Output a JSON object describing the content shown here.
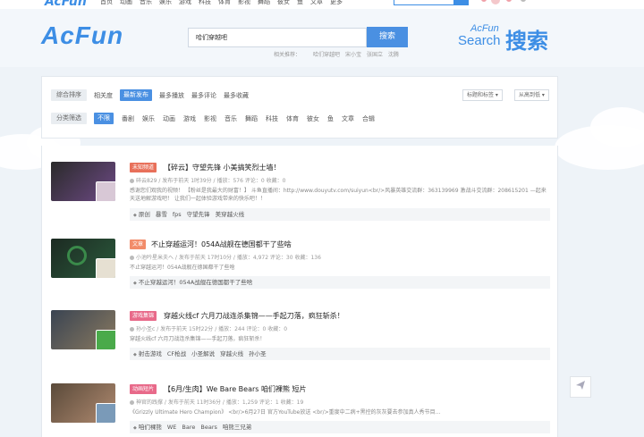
{
  "topbar": {
    "logo": "AcFun",
    "nav": [
      "首页",
      "动画",
      "音乐",
      "娱乐",
      "游戏",
      "科技",
      "体育",
      "影视",
      "舞蹈",
      "彼女",
      "鱼",
      "文章",
      "更多"
    ],
    "search_placeholder": "搜索"
  },
  "header": {
    "logo": "AcFun",
    "search_value": "哈们穿越吧",
    "search_button": "搜索",
    "hot_label": "相关推荐：",
    "hot_links": [
      "哈们穿越吧",
      "宋小宝",
      "张国立",
      "沈腾"
    ],
    "brand_en1": "AcFun",
    "brand_en2": "Search",
    "brand_cn": "搜索"
  },
  "filters": {
    "sort_label": "综合排序",
    "sort_items": [
      "相关度",
      "最新发布",
      "最多播放",
      "最多评论",
      "最多收藏"
    ],
    "sort_active": 1,
    "cat_label": "分类筛选",
    "cat_items": [
      "不限",
      "番剧",
      "娱乐",
      "动画",
      "游戏",
      "影视",
      "音乐",
      "舞蹈",
      "科技",
      "体育",
      "彼女",
      "鱼",
      "文章",
      "合辑"
    ],
    "cat_active": 0,
    "select_tags": "标题和标签 ▾",
    "select_time": "从高到低 ▾"
  },
  "entries": [
    {
      "tag": "未知频道",
      "tag_color": "#e8705a",
      "title": "【碎云】守望先锋 小美搞笑烈士墙！",
      "meta": "碎云829 / 发布于前天 1时39分 / 播放：576  评论：0  收藏：0",
      "desc": "感谢您们观我的视频！ 【粉丝是我最大的财富！】 斗鱼直播间：http://www.douyutv.com/suiyun<br/>风暴英雄交流群：363139969 激战斗交流群：208615201 —起来天送地解游戏吧！ 让我们一起体验游戏带来的快乐吧！！",
      "tags": [
        "原创",
        "暴雪",
        "fps",
        "守望先锋",
        "美穿越火线"
      ]
    },
    {
      "tag": "文章",
      "tag_color": "#f28c6a",
      "title": "不止穿越运河！054A战舰在德国都干了些啥",
      "meta": "小池吟星米夫へ / 发布于前天 17时10分 / 播放：4,972  评论：30  收藏：136",
      "desc": "不止穿越运河！054A战舰在德国都干了些啥",
      "tags": [
        "不止穿越运河！054A战舰在德国都干了些啥"
      ]
    },
    {
      "tag": "游戏集锦",
      "tag_color": "#e86a8a",
      "title": "穿越火线cf 六月刀战连杀集锦——手起刀落，疯狂斩杀！",
      "meta": "孙小圣c / 发布于前天 15时22分 / 播放：244  评论：0  收藏：0",
      "desc": "穿越火线cf 六月刀战连杀集锦——手起刀落，疯狂斩杀！",
      "tags": [
        "射击游戏",
        "CF枪战",
        "小圣解说",
        "穿越火线",
        "孙小圣"
      ]
    },
    {
      "tag": "动画短片",
      "tag_color": "#e86a8a",
      "title": "【6月/生肉】We Bare Bears 咱们裸熊 短片",
      "meta": "神官的践撑 / 发布于前天 11时36分 / 播放：1,259  评论：1  收藏：19",
      "desc": "《Grizzly Ultimate Hero Champion》 <br/>6月27日 官方YouTube放送 <br/>重度中二病+黑控的灰灰要去参加真人秀节目…",
      "tags": [
        "咱们裸熊",
        "WE",
        "Bare",
        "Bears",
        "咱熊三兄弟"
      ]
    }
  ],
  "share_icon": "paper-plane-icon"
}
